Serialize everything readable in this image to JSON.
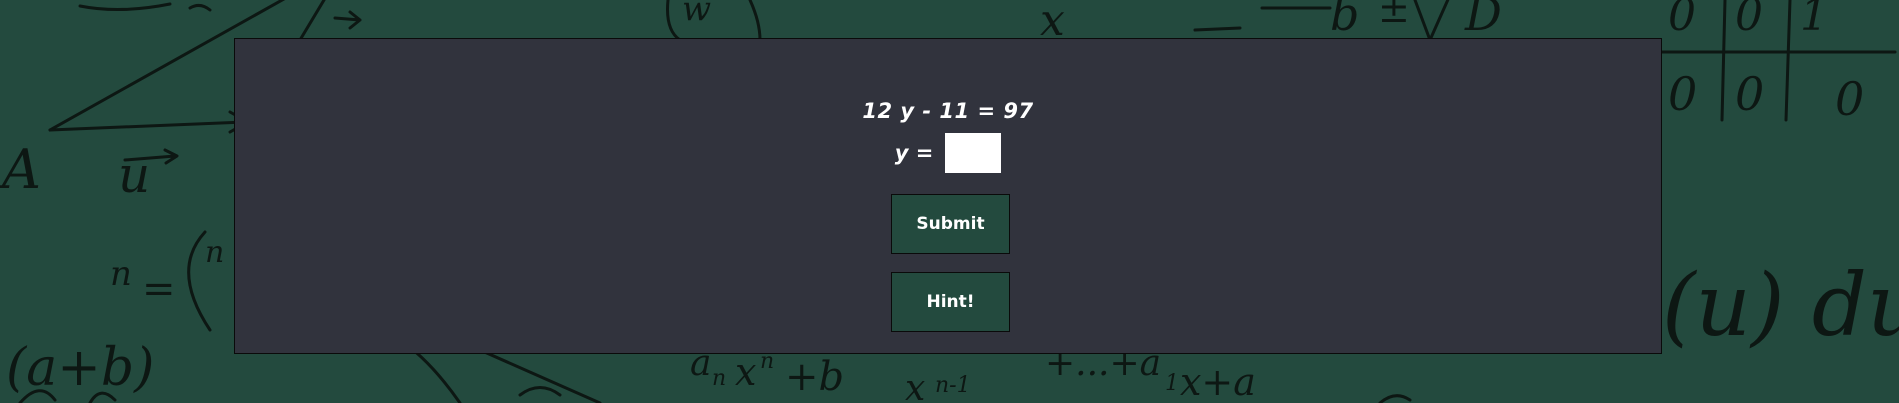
{
  "colors": {
    "background": "#234a3e",
    "panel": "#31333d",
    "button": "#234a3e",
    "text": "#ffffff",
    "input": "#ffffff"
  },
  "problem": {
    "equation": "12 y - 11 = 97",
    "variable_label": "y =",
    "answer_value": ""
  },
  "buttons": {
    "submit_label": "Submit",
    "hint_label": "Hint!"
  }
}
